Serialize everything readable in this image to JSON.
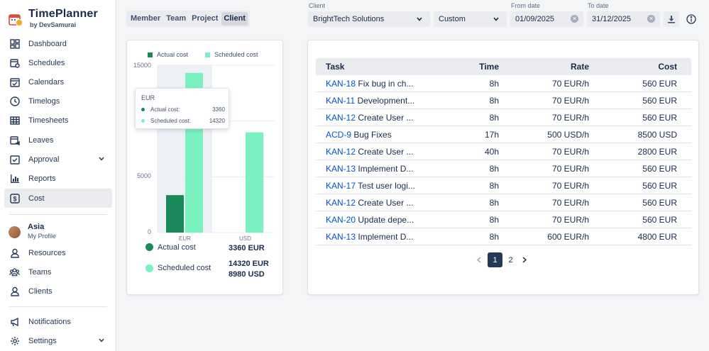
{
  "brand": {
    "title": "TimePlanner",
    "subtitle": "by DevSamurai"
  },
  "sidebar": {
    "items": [
      {
        "label": "Dashboard",
        "icon": "dashboard-icon"
      },
      {
        "label": "Schedules",
        "icon": "calendar-clock-icon"
      },
      {
        "label": "Calendars",
        "icon": "calendar-check-icon"
      },
      {
        "label": "Timelogs",
        "icon": "clock-icon"
      },
      {
        "label": "Timesheets",
        "icon": "table-icon"
      },
      {
        "label": "Leaves",
        "icon": "calendar-leave-icon"
      },
      {
        "label": "Approval",
        "icon": "approval-icon"
      },
      {
        "label": "Reports",
        "icon": "bar-chart-icon"
      },
      {
        "label": "Cost",
        "icon": "dollar-icon"
      }
    ],
    "profile": {
      "name": "Asia",
      "sub": "My Profile"
    },
    "lower_items": [
      {
        "label": "Resources",
        "icon": "person-icon"
      },
      {
        "label": "Teams",
        "icon": "group-icon"
      },
      {
        "label": "Clients",
        "icon": "client-icon"
      }
    ],
    "bottom_items": [
      {
        "label": "Notifications",
        "icon": "megaphone-icon"
      },
      {
        "label": "Settings",
        "icon": "gear-icon"
      }
    ]
  },
  "toolbar": {
    "tabs": [
      "Member",
      "Team",
      "Project",
      "Client"
    ],
    "active_tab": "Client",
    "client_label": "Client",
    "client_value": "BrightTech Solutions",
    "range_value": "Custom",
    "from_label": "From date",
    "from_value": "01/09/2025",
    "to_label": "To date",
    "to_value": "31/12/2025"
  },
  "chart_data": {
    "type": "bar",
    "categories": [
      "EUR",
      "USD"
    ],
    "series": [
      {
        "name": "Actual cost",
        "values": [
          3360,
          0
        ]
      },
      {
        "name": "Scheduled cost",
        "values": [
          14320,
          8980
        ]
      }
    ],
    "ylim": [
      0,
      15000
    ],
    "yticks": [
      "15000",
      "5000",
      "0"
    ],
    "legend": "top",
    "tooltip": {
      "title": "EUR",
      "rows": [
        {
          "label": "Actual cost:",
          "value": "3360"
        },
        {
          "label": "Scheduled cost:",
          "value": "14320"
        }
      ]
    },
    "summary": {
      "actual_label": "Actual cost",
      "actual_value": "3360 EUR",
      "scheduled_label": "Scheduled cost",
      "scheduled_value_1": "14320 EUR",
      "scheduled_value_2": "8980 USD"
    },
    "colors": {
      "actual": "#1b8a5a",
      "scheduled": "#79f2c0",
      "highlight": "#eef0f7"
    }
  },
  "table": {
    "headers": {
      "task": "Task",
      "time": "Time",
      "rate": "Rate",
      "cost": "Cost"
    },
    "rows": [
      {
        "key": "KAN-18",
        "name": "Fix bug in ch...",
        "time": "8h",
        "rate": "70 EUR/h",
        "cost": "560 EUR"
      },
      {
        "key": "KAN-11",
        "name": "Development...",
        "time": "8h",
        "rate": "70 EUR/h",
        "cost": "560 EUR"
      },
      {
        "key": "KAN-12",
        "name": "Create User ...",
        "time": "8h",
        "rate": "70 EUR/h",
        "cost": "560 EUR"
      },
      {
        "key": "ACD-9",
        "name": "Bug Fixes",
        "time": "17h",
        "rate": "500 USD/h",
        "cost": "8500 USD"
      },
      {
        "key": "KAN-12",
        "name": "Create User ...",
        "time": "40h",
        "rate": "70 EUR/h",
        "cost": "2800 EUR"
      },
      {
        "key": "KAN-13",
        "name": "Implement D...",
        "time": "8h",
        "rate": "70 EUR/h",
        "cost": "560 EUR"
      },
      {
        "key": "KAN-17",
        "name": "Test user logi...",
        "time": "8h",
        "rate": "70 EUR/h",
        "cost": "560 EUR"
      },
      {
        "key": "KAN-12",
        "name": "Create User ...",
        "time": "8h",
        "rate": "70 EUR/h",
        "cost": "560 EUR"
      },
      {
        "key": "KAN-20",
        "name": "Update depe...",
        "time": "8h",
        "rate": "70 EUR/h",
        "cost": "560 EUR"
      },
      {
        "key": "KAN-13",
        "name": "Implement D...",
        "time": "8h",
        "rate": "600 EUR/h",
        "cost": "4800 EUR"
      }
    ],
    "pages": [
      "1",
      "2"
    ],
    "current_page": "1"
  }
}
